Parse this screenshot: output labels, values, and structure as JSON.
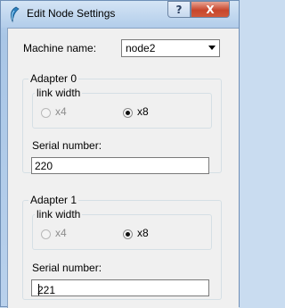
{
  "window": {
    "title": "Edit Node Settings",
    "help_label": "?",
    "close_label": "X"
  },
  "machine": {
    "label": "Machine name:",
    "selected": "node2"
  },
  "adapters": [
    {
      "title": "Adapter 0",
      "link_width_label": "link width",
      "options": [
        {
          "label": "x4",
          "checked": false
        },
        {
          "label": "x8",
          "checked": true
        }
      ],
      "serial_label": "Serial number:",
      "serial_value": "220"
    },
    {
      "title": "Adapter 1",
      "link_width_label": "link width",
      "options": [
        {
          "label": "x4",
          "checked": false
        },
        {
          "label": "x8",
          "checked": true
        }
      ],
      "serial_label": "Serial number:",
      "serial_value": "221"
    }
  ]
}
